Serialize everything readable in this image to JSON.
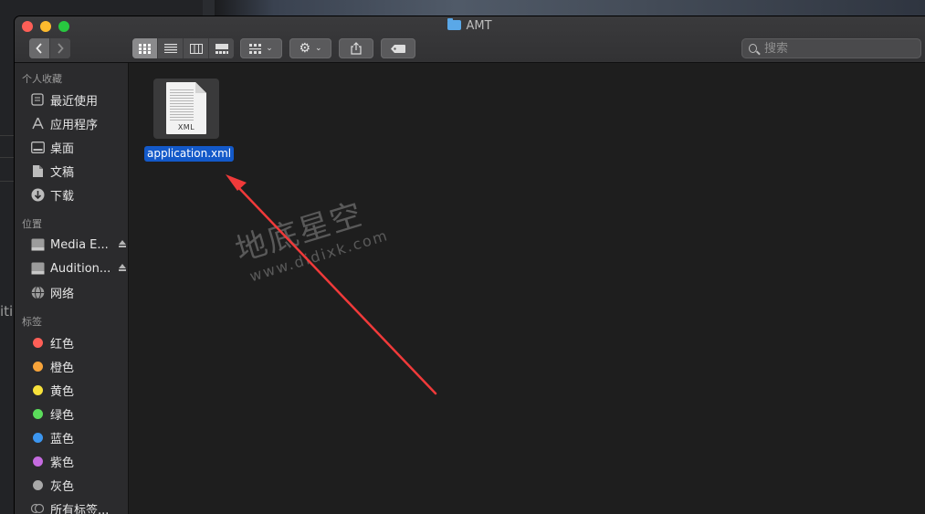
{
  "window": {
    "title": "AMT"
  },
  "toolbar": {
    "back_icon": "chevron-left-icon",
    "forward_icon": "chevron-right-icon",
    "view_icons": [
      "icon-view-icon",
      "list-view-icon",
      "column-view-icon",
      "gallery-view-icon"
    ],
    "search_placeholder": "搜索"
  },
  "sidebar": {
    "favorites_title": "个人收藏",
    "favorites": [
      {
        "label": "最近使用",
        "icon": "recents-icon"
      },
      {
        "label": "应用程序",
        "icon": "applications-icon"
      },
      {
        "label": "桌面",
        "icon": "desktop-icon"
      },
      {
        "label": "文稿",
        "icon": "documents-icon"
      },
      {
        "label": "下载",
        "icon": "downloads-icon"
      }
    ],
    "locations_title": "位置",
    "locations": [
      {
        "label": "Media E...",
        "icon": "disk-icon"
      },
      {
        "label": "Audition...",
        "icon": "disk-icon"
      },
      {
        "label": "网络",
        "icon": "network-icon"
      }
    ],
    "tags_title": "标签",
    "tags": [
      {
        "label": "红色",
        "color": "#ff5f57"
      },
      {
        "label": "橙色",
        "color": "#f8a43a"
      },
      {
        "label": "黄色",
        "color": "#f7e13b"
      },
      {
        "label": "绿色",
        "color": "#5bdc5b"
      },
      {
        "label": "蓝色",
        "color": "#3c96f0"
      },
      {
        "label": "紫色",
        "color": "#c56be0"
      },
      {
        "label": "灰色",
        "color": "#a8a8a8"
      },
      {
        "label": "所有标签..."
      }
    ]
  },
  "content": {
    "file": {
      "name": "application.xml",
      "ext": "XML"
    }
  },
  "watermark": {
    "line1": "地底星空",
    "line2": "www.didixk.com"
  },
  "background": {
    "fragment": "iti"
  },
  "colors": {
    "selection": "#1359c9",
    "arrow": "#f03a3a"
  }
}
